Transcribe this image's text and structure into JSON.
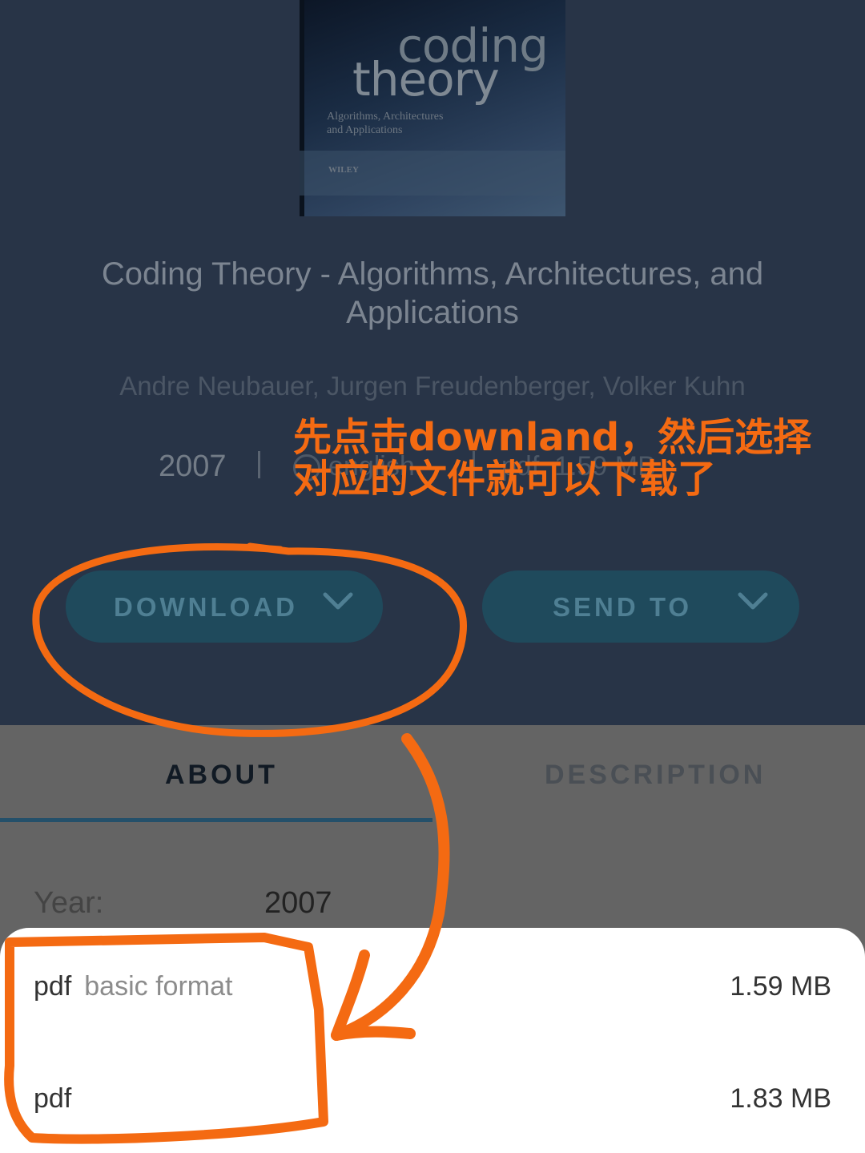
{
  "book": {
    "cover_title_line1": "coding",
    "cover_title_line2": "theory",
    "cover_subtitle": "Algorithms, Architectures\nand Applications",
    "cover_publisher": "WILEY",
    "title": "Coding Theory - Algorithms, Architectures, and Applications",
    "authors": "Andre Neubauer, Jurgen Freudenberger, Volker Kuhn",
    "year": "2007",
    "language": "english",
    "file": "pdf, 1.59 MB"
  },
  "actions": {
    "download_label": "DOWNLOAD",
    "send_label": "SEND TO"
  },
  "annotation": {
    "text": "先点击downland，然后选择\n对应的文件就可以下载了",
    "color": "#f46a12"
  },
  "tabs": {
    "about": "ABOUT",
    "description": "DESCRIPTION"
  },
  "details": {
    "year_label": "Year:",
    "year_value": "2007"
  },
  "download_options": [
    {
      "format": "pdf",
      "hint": "basic format",
      "size": "1.59 MB"
    },
    {
      "format": "pdf",
      "hint": "",
      "size": "1.83 MB"
    }
  ],
  "icons": {
    "chevron": "chevron-down-icon",
    "globe": "globe-icon",
    "file": "file-icon"
  }
}
